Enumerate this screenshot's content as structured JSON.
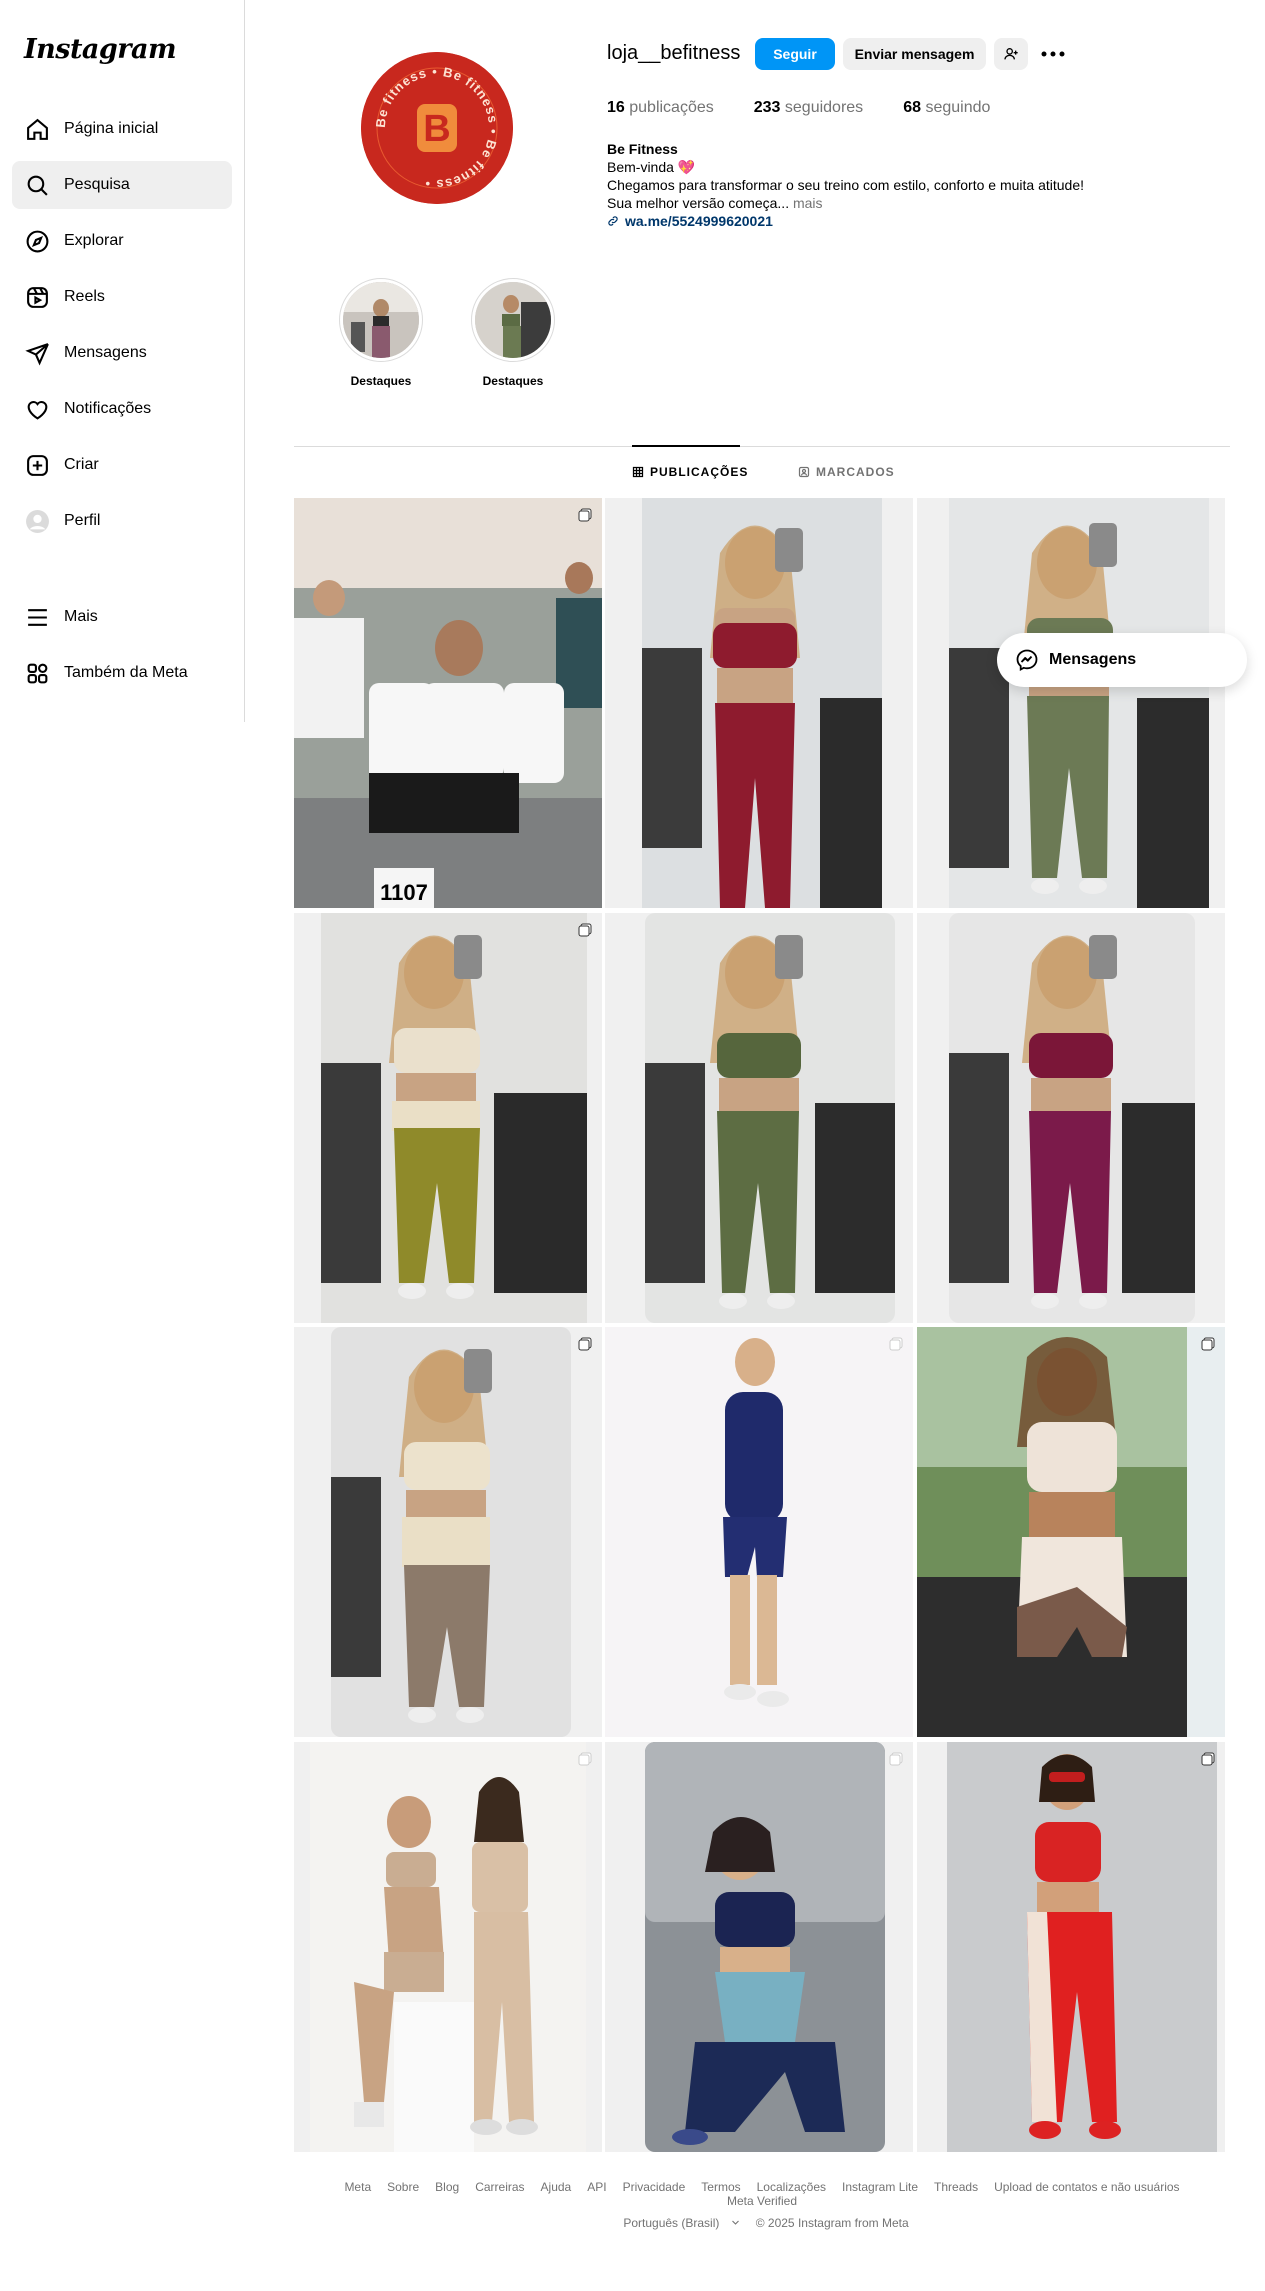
{
  "app": {
    "logo_text": "Instagram"
  },
  "sidebar": {
    "items": [
      {
        "label": "Página inicial",
        "icon": "home-icon"
      },
      {
        "label": "Pesquisa",
        "icon": "search-icon"
      },
      {
        "label": "Explorar",
        "icon": "compass-icon"
      },
      {
        "label": "Reels",
        "icon": "reels-icon"
      },
      {
        "label": "Mensagens",
        "icon": "send-icon"
      },
      {
        "label": "Notificações",
        "icon": "heart-icon"
      },
      {
        "label": "Criar",
        "icon": "plus-square-icon"
      },
      {
        "label": "Perfil",
        "icon": "avatar-icon"
      },
      {
        "label": "Mais",
        "icon": "menu-icon"
      },
      {
        "label": "Também da Meta",
        "icon": "meta-apps-icon"
      }
    ]
  },
  "profile": {
    "username": "loja__befitness",
    "avatar_text": "Be fitness",
    "follow_label": "Seguir",
    "message_label": "Enviar mensagem",
    "stats": {
      "posts_count": "16",
      "posts_label": "publicações",
      "followers_count": "233",
      "followers_label": "seguidores",
      "following_count": "68",
      "following_label": "seguindo"
    },
    "bio": {
      "name": "Be Fitness",
      "line1": "Bem-vinda 💖",
      "line2": "Chegamos para transformar o seu treino com estilo, conforto e muita atitude!",
      "line3": "Sua melhor versão começa...",
      "more": "mais",
      "link": "wa.me/5524999620021"
    }
  },
  "highlights": [
    {
      "label": "Destaques"
    },
    {
      "label": "Destaques"
    }
  ],
  "tabs": {
    "posts": "PUBLICAÇÕES",
    "tagged": "MARCADOS"
  },
  "posts": [
    {
      "description": "runner",
      "multi": true
    },
    {
      "description": "burgundy set",
      "multi": false
    },
    {
      "description": "olive set",
      "multi": false
    },
    {
      "description": "cream olive set",
      "multi": true
    },
    {
      "description": "green set",
      "multi": false
    },
    {
      "description": "purple set",
      "multi": false
    },
    {
      "description": "cream brown set",
      "multi": true
    },
    {
      "description": "navy jumpsuit",
      "multi": true
    },
    {
      "description": "cream bronze set",
      "multi": true
    },
    {
      "description": "beige duo",
      "multi": true
    },
    {
      "description": "navy blue set",
      "multi": true
    },
    {
      "description": "red set",
      "multi": true
    }
  ],
  "floating": {
    "label": "Mensagens"
  },
  "footer": {
    "links": [
      "Meta",
      "Sobre",
      "Blog",
      "Carreiras",
      "Ajuda",
      "API",
      "Privacidade",
      "Termos",
      "Localizações",
      "Instagram Lite",
      "Threads",
      "Upload de contatos e não usuários",
      "Meta Verified"
    ],
    "language": "Português (Brasil)",
    "copyright": "© 2025 Instagram from Meta"
  }
}
